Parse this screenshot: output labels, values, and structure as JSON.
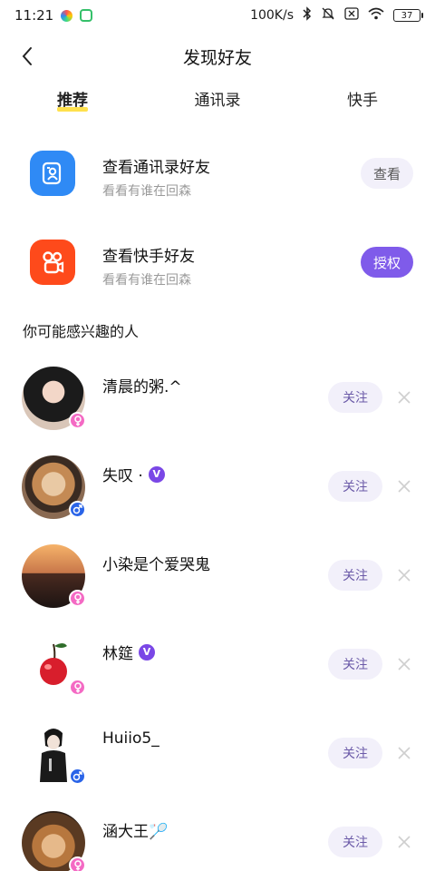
{
  "status_bar": {
    "time": "11:21",
    "net_speed": "100K/s",
    "battery": "37"
  },
  "header": {
    "title": "发现好友"
  },
  "tabs": [
    {
      "label": "推荐",
      "active": true
    },
    {
      "label": "通讯录",
      "active": false
    },
    {
      "label": "快手",
      "active": false
    }
  ],
  "connect": [
    {
      "title": "查看通讯录好友",
      "subtitle": "看看有谁在回森",
      "button": "查看",
      "icon": "contacts-icon",
      "color": "#2f8af5"
    },
    {
      "title": "查看快手好友",
      "subtitle": "看看有谁在回森",
      "button": "授权",
      "icon": "kuaishou-icon",
      "color": "#fe4a1b"
    }
  ],
  "section_title": "你可能感兴趣的人",
  "people": [
    {
      "name": "清晨的粥.^",
      "gender": "female",
      "verified": false,
      "follow": "关注"
    },
    {
      "name": "失叹 ·",
      "gender": "male",
      "verified": true,
      "follow": "关注"
    },
    {
      "name": "小染是个爱哭鬼",
      "gender": "female",
      "verified": false,
      "follow": "关注"
    },
    {
      "name": "林筵",
      "gender": "female",
      "verified": true,
      "follow": "关注"
    },
    {
      "name": "Huiio5_",
      "gender": "male",
      "verified": false,
      "follow": "关注"
    },
    {
      "name": "涵大王🏸",
      "gender": "female",
      "verified": false,
      "follow": "关注"
    }
  ],
  "colors": {
    "accent_purple": "#7f5bea",
    "verified_purple": "#7a47e6",
    "tab_underline": "#ffe14d",
    "female": "#f46ac4",
    "male": "#2a64e8"
  }
}
